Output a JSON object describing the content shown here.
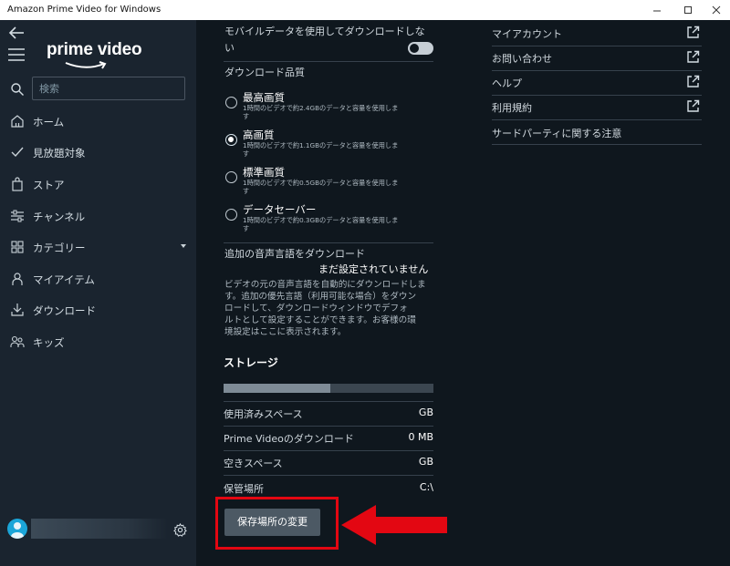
{
  "window": {
    "title": "Amazon Prime Video for Windows"
  },
  "sidebar": {
    "logo_text": "prime video",
    "search_placeholder": "検索",
    "items": [
      {
        "label": "ホーム",
        "icon": "home-icon"
      },
      {
        "label": "見放題対象",
        "icon": "check-icon"
      },
      {
        "label": "ストア",
        "icon": "shopping-bag-icon"
      },
      {
        "label": "チャンネル",
        "icon": "sliders-icon"
      },
      {
        "label": "カテゴリー",
        "icon": "grid-icon"
      },
      {
        "label": "マイアイテム",
        "icon": "person-icon"
      },
      {
        "label": "ダウンロード",
        "icon": "download-icon"
      },
      {
        "label": "キッズ",
        "icon": "kids-icon"
      }
    ]
  },
  "settings": {
    "mobile_data_label_1": "モバイルデータを使用してダウンロードしな",
    "mobile_data_label_2": "い",
    "mobile_data_enabled": false,
    "quality_title": "ダウンロード品質",
    "quality_options": [
      {
        "title": "最高画質",
        "desc": "1時間のビデオで約2.4GBのデータと容量を使用しま",
        "desc2": "す",
        "selected": false
      },
      {
        "title": "高画質",
        "desc": "1時間のビデオで約1.1GBのデータと容量を使用しま",
        "desc2": "す",
        "selected": true
      },
      {
        "title": "標準画質",
        "desc": "1時間のビデオで約0.5GBのデータと容量を使用しま",
        "desc2": "す",
        "selected": false
      },
      {
        "title": "データセーバー",
        "desc": "1時間のビデオで約0.3GBのデータと容量を使用しま",
        "desc2": "す",
        "selected": false
      }
    ],
    "audio_title": "追加の音声言語をダウンロード",
    "audio_value": "まだ設定されていません",
    "audio_desc": [
      "ビデオの元の音声言語を自動的にダウンロードしま",
      "す。追加の優先言語（利用可能な場合）をダウン",
      "ロードして、ダウンロードウィンドウでデフォ",
      "ルトとして設定することができます。お客様の環",
      "境設定はここに表示されます。"
    ],
    "storage_title": "ストレージ",
    "storage_used_fraction": 0.51,
    "storage_rows": [
      {
        "label": "使用済みスペース",
        "value": "GB"
      },
      {
        "label": "Prime Videoのダウンロード",
        "value": "0 MB"
      },
      {
        "label": "空きスペース",
        "value": "GB"
      },
      {
        "label": "保管場所",
        "value": "C:\\"
      }
    ],
    "change_location_button": "保存場所の変更"
  },
  "links": [
    {
      "label": "マイアカウント",
      "external": true
    },
    {
      "label": "お問い合わせ",
      "external": true
    },
    {
      "label": "ヘルプ",
      "external": true
    },
    {
      "label": "利用規約",
      "external": true
    },
    {
      "label": "サードパーティに関する注意",
      "external": false
    }
  ],
  "colors": {
    "background": "#0f171e",
    "sidebar": "#1a242f",
    "button": "#4c5964",
    "annotation_red": "#e30712"
  }
}
